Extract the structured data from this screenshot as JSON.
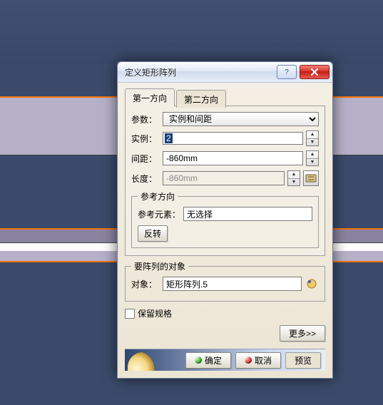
{
  "titlebar": {
    "title": "定义矩形阵列"
  },
  "tabs": {
    "tab1": "第一方向",
    "tab2": "第二方向"
  },
  "params": {
    "label": "参数：",
    "selected": "实例和间距"
  },
  "instances": {
    "label": "实例：",
    "value": "2"
  },
  "spacing": {
    "label": "间距：",
    "value": "-860mm"
  },
  "length": {
    "label": "长度：",
    "value": "-860mm"
  },
  "refdir": {
    "legend": "参考方向",
    "elem_label": "参考元素：",
    "elem_value": "无选择",
    "reverse": "反转"
  },
  "targetgroup": {
    "legend": "要阵列的对象",
    "obj_label": "对象：",
    "obj_value": "矩形阵列.5"
  },
  "keep_spec": "保留规格",
  "buttons": {
    "more": "更多>>",
    "ok": "确定",
    "cancel": "取消",
    "preview": "预览"
  }
}
